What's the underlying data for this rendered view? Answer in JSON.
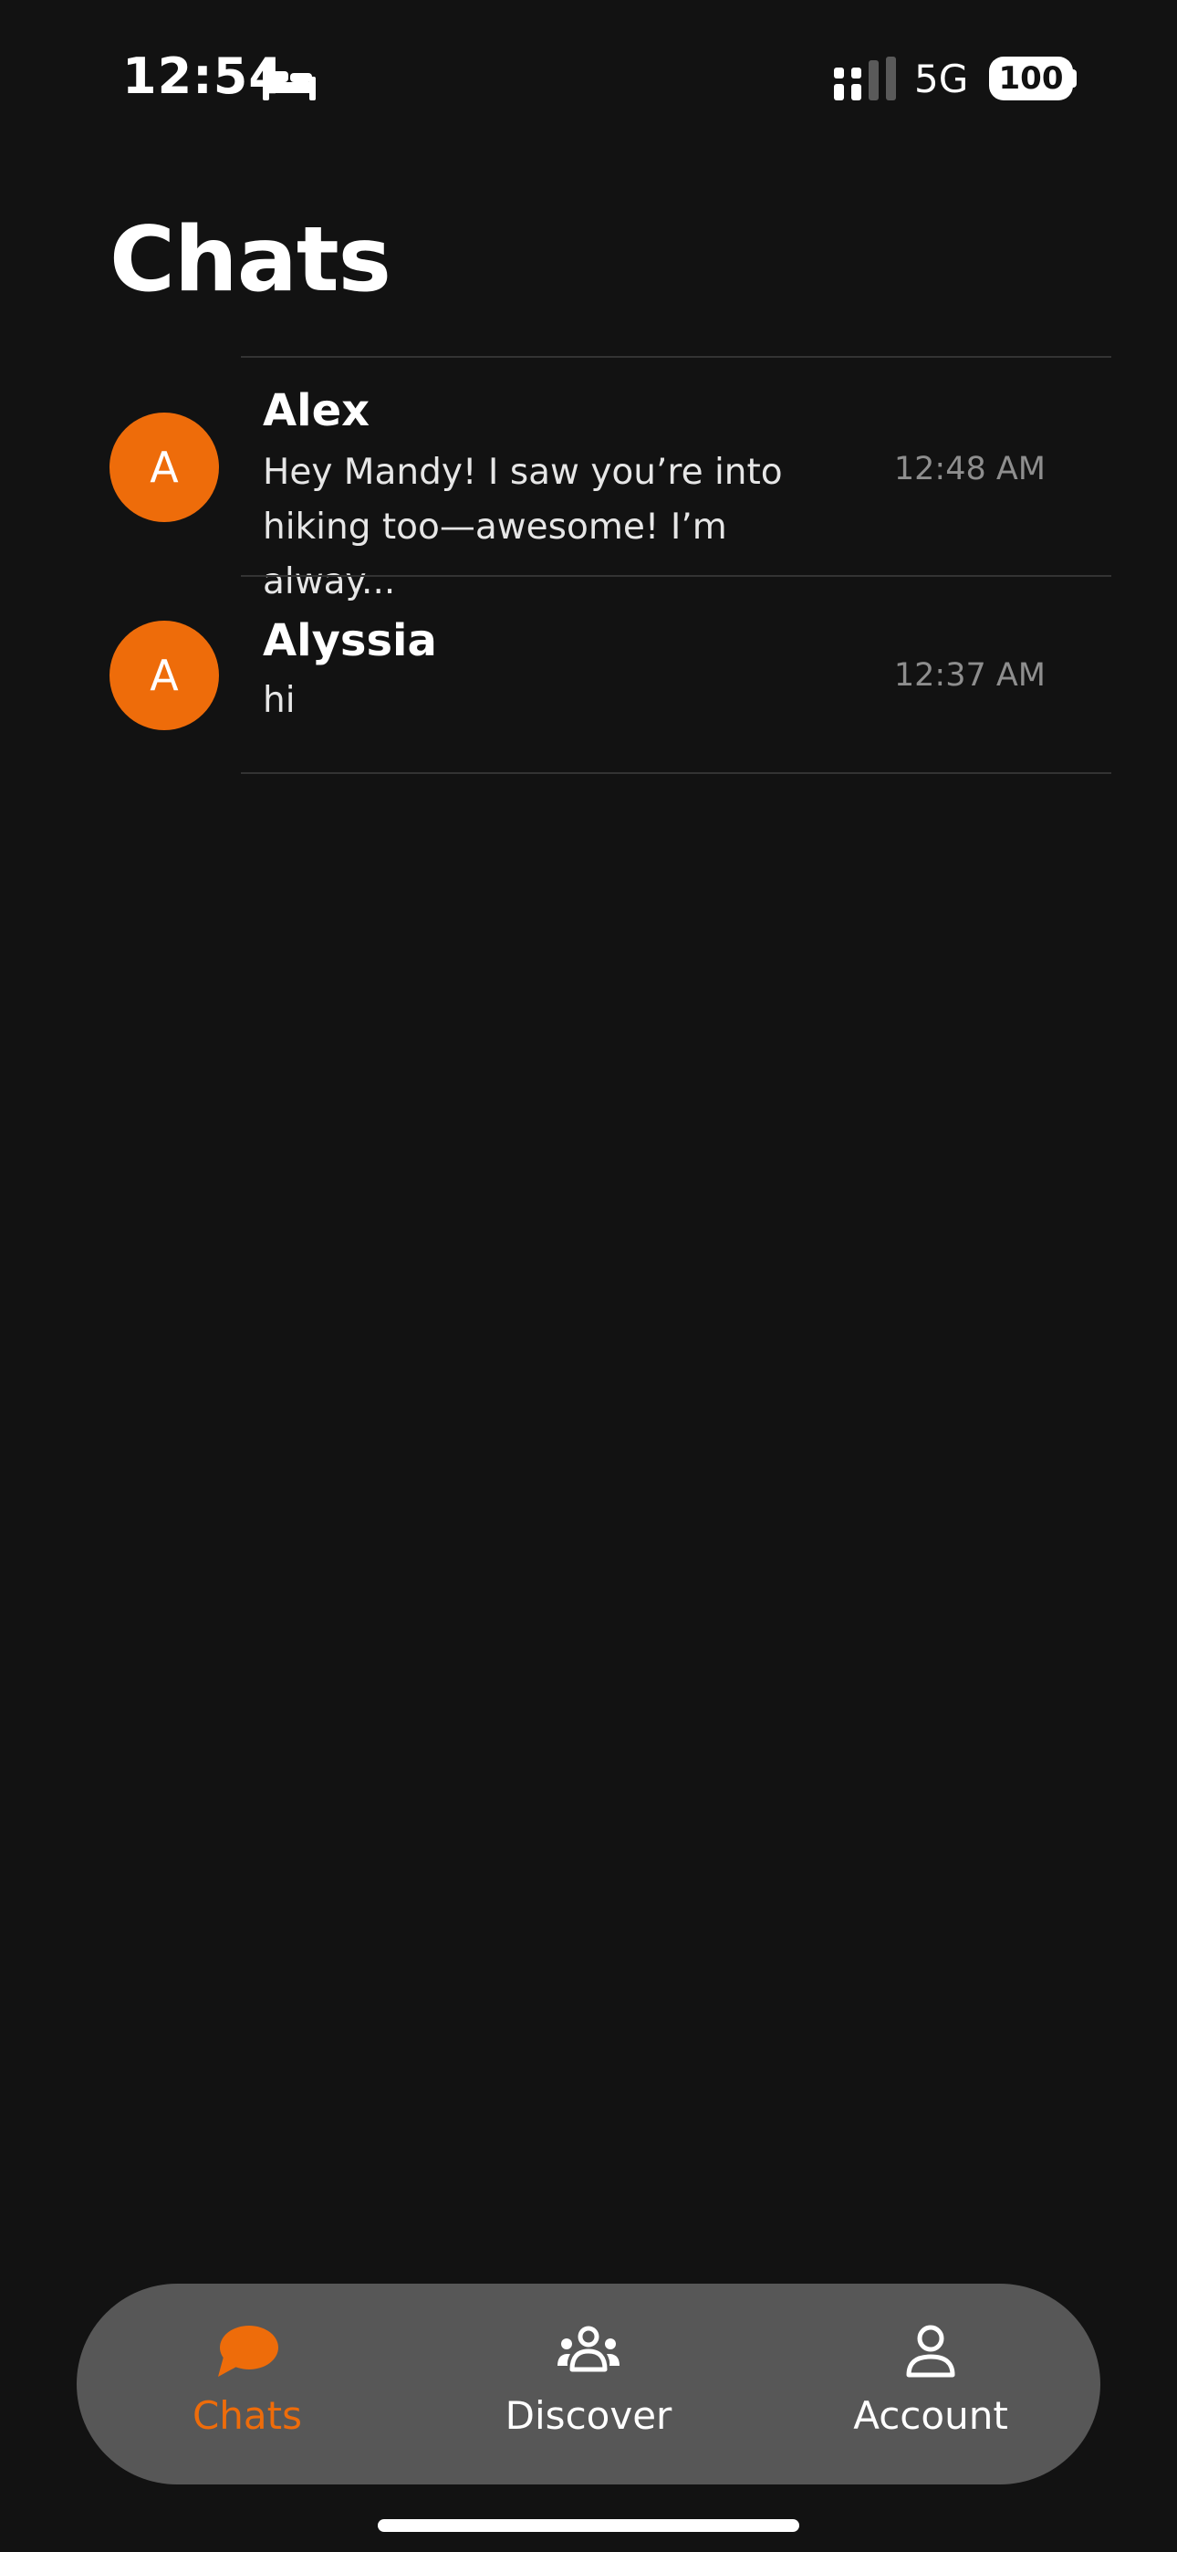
{
  "status_bar": {
    "time": "12:54",
    "network": "5G",
    "battery": "100",
    "icons": [
      "bed-icon",
      "cellular-signal-icon",
      "battery-icon"
    ]
  },
  "header": {
    "title": "Chats"
  },
  "chats": [
    {
      "avatar_initial": "A",
      "name": "Alex",
      "preview": "Hey Mandy! I saw you’re into hiking too—awesome! I’m alway...",
      "time": "12:48 AM"
    },
    {
      "avatar_initial": "A",
      "name": "Alyssia",
      "preview": "hi",
      "time": "12:37 AM"
    }
  ],
  "tab_bar": {
    "tabs": [
      {
        "label": "Chats",
        "icon": "chat-bubble-icon",
        "active": true
      },
      {
        "label": "Discover",
        "icon": "people-group-icon",
        "active": false
      },
      {
        "label": "Account",
        "icon": "person-icon",
        "active": false
      }
    ]
  },
  "colors": {
    "background": "#121212",
    "accent": "#EE6C0A",
    "tab_bar": "#575757",
    "muted_text": "#8e8e8e",
    "divider": "#333333"
  }
}
